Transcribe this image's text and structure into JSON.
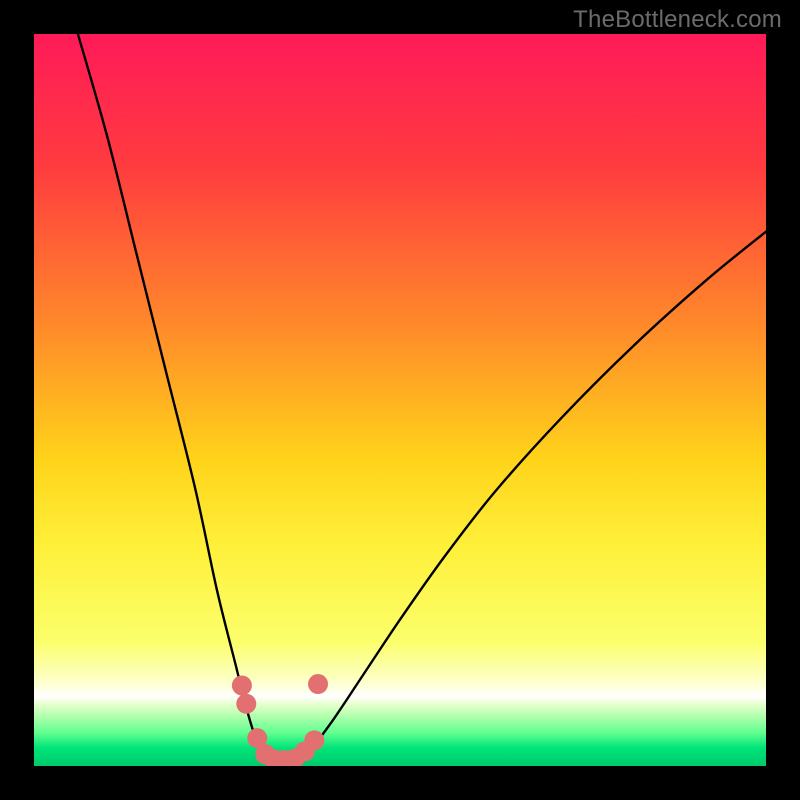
{
  "watermark": "TheBottleneck.com",
  "chart_data": {
    "type": "line",
    "title": "",
    "xlabel": "",
    "ylabel": "",
    "xlim": [
      0,
      100
    ],
    "ylim": [
      0,
      100
    ],
    "grid": false,
    "legend": false,
    "gradient_stops": [
      {
        "offset": 0.0,
        "color": "#ff1a58"
      },
      {
        "offset": 0.18,
        "color": "#ff3b3f"
      },
      {
        "offset": 0.4,
        "color": "#ff8a2a"
      },
      {
        "offset": 0.58,
        "color": "#ffd31a"
      },
      {
        "offset": 0.7,
        "color": "#fff03a"
      },
      {
        "offset": 0.83,
        "color": "#fbff6b"
      },
      {
        "offset": 0.88,
        "color": "#fdffc0"
      },
      {
        "offset": 0.905,
        "color": "#ffffff"
      },
      {
        "offset": 0.915,
        "color": "#e8ffd0"
      },
      {
        "offset": 0.93,
        "color": "#b8ffb0"
      },
      {
        "offset": 0.955,
        "color": "#5fff8f"
      },
      {
        "offset": 0.975,
        "color": "#00e57a"
      },
      {
        "offset": 1.0,
        "color": "#00c96b"
      }
    ],
    "series": [
      {
        "name": "left-branch",
        "type": "curve",
        "x": [
          6.0,
          10.0,
          14.0,
          18.0,
          22.0,
          25.0,
          27.5,
          29.0,
          30.2,
          31.2,
          32.0
        ],
        "y": [
          100.0,
          86.0,
          70.0,
          54.0,
          38.0,
          24.0,
          14.0,
          8.0,
          4.0,
          1.5,
          0.5
        ]
      },
      {
        "name": "right-branch",
        "type": "curve",
        "x": [
          36.0,
          38.0,
          41.0,
          45.0,
          50.0,
          56.0,
          63.0,
          72.0,
          82.0,
          92.0,
          100.0
        ],
        "y": [
          0.5,
          2.5,
          6.5,
          12.5,
          20.0,
          28.5,
          37.5,
          47.5,
          57.5,
          66.5,
          73.0
        ]
      },
      {
        "name": "floor",
        "type": "curve",
        "x": [
          32.0,
          33.0,
          34.0,
          35.0,
          36.0
        ],
        "y": [
          0.5,
          0.2,
          0.2,
          0.2,
          0.5
        ]
      }
    ],
    "markers": {
      "name": "highlight-dots",
      "color": "#e27070",
      "radius": 10,
      "points": [
        {
          "x": 28.4,
          "y": 11.0
        },
        {
          "x": 29.0,
          "y": 8.5
        },
        {
          "x": 30.5,
          "y": 3.8
        },
        {
          "x": 31.6,
          "y": 1.6
        },
        {
          "x": 32.8,
          "y": 0.9
        },
        {
          "x": 34.2,
          "y": 0.8
        },
        {
          "x": 35.6,
          "y": 1.0
        },
        {
          "x": 37.0,
          "y": 2.0
        },
        {
          "x": 38.3,
          "y": 3.5
        },
        {
          "x": 38.8,
          "y": 11.2
        }
      ]
    }
  }
}
